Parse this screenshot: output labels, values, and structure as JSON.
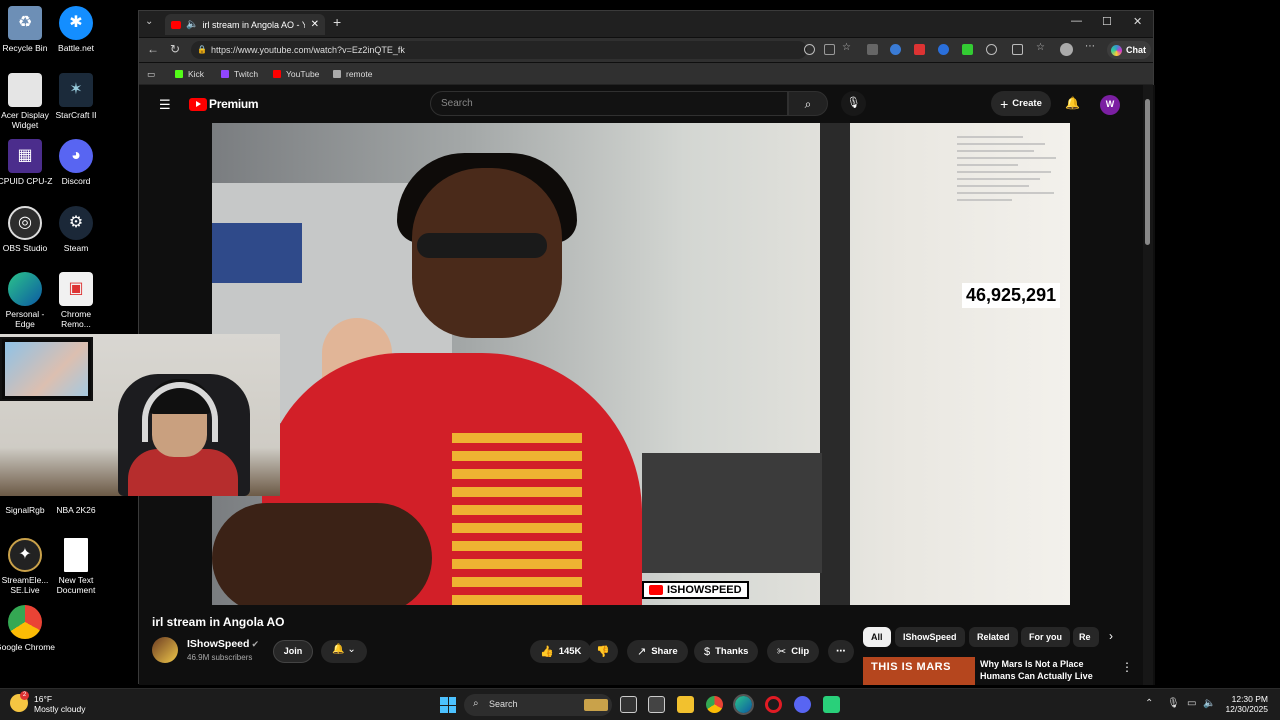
{
  "desktop": {
    "icons": [
      {
        "label": "Recycle Bin",
        "icon": "recycle-bin-icon"
      },
      {
        "label": "Battle.net",
        "icon": "battlenet-icon"
      },
      {
        "label": "Acer Display Widget",
        "icon": "acer-icon"
      },
      {
        "label": "StarCraft II",
        "icon": "starcraft-icon"
      },
      {
        "label": "CPUID CPU-Z",
        "icon": "cpuz-icon"
      },
      {
        "label": "Discord",
        "icon": "discord-icon"
      },
      {
        "label": "OBS Studio",
        "icon": "obs-icon"
      },
      {
        "label": "Steam",
        "icon": "steam-icon"
      },
      {
        "label": "Personal - Edge",
        "icon": "edge-icon"
      },
      {
        "label": "Chrome Remo...",
        "icon": "chrome-remote-icon"
      },
      {
        "label": "SignalRgb",
        "icon": "signalrgb-icon"
      },
      {
        "label": "NBA 2K26",
        "icon": "nba-icon"
      },
      {
        "label": "StreamEle... SE.Live",
        "icon": "streamelements-icon"
      },
      {
        "label": "New Text Document",
        "icon": "text-document-icon"
      },
      {
        "label": "Google Chrome",
        "icon": "chrome-icon"
      }
    ]
  },
  "browser": {
    "tab_title": "irl stream in Angola AO - YouTube",
    "url": "https://www.youtube.com/watch?v=Ez2inQTE_fk",
    "chat_label": "Chat",
    "bookmarks": [
      {
        "label": "Kick",
        "color": "#53fc18"
      },
      {
        "label": "Twitch",
        "color": "#9146ff"
      },
      {
        "label": "YouTube",
        "color": "#ff0000"
      },
      {
        "label": "remote",
        "color": "#aaaaaa"
      }
    ]
  },
  "youtube": {
    "brand": "Premium",
    "search_placeholder": "Search",
    "create_label": "Create",
    "avatar_letter": "W",
    "video": {
      "counter": "46,925,291",
      "watermark": "ISHOWSPEED"
    },
    "title": "irl stream in Angola AO",
    "channel": "IShowSpeed",
    "subscribers": "46.9M subscribers",
    "join_label": "Join",
    "actions": {
      "likes": "145K",
      "share": "Share",
      "thanks": "Thanks",
      "clip": "Clip"
    },
    "chips": [
      "All",
      "IShowSpeed",
      "Related",
      "For you",
      "Re"
    ],
    "recommendation": {
      "thumb_text": "THIS IS MARS",
      "title": "Why Mars Is Not a Place Humans Can Actually Live"
    }
  },
  "taskbar": {
    "temperature": "16°F",
    "weather": "Mostly cloudy",
    "notification_count": "2",
    "search": "Search",
    "time": "12:30 PM",
    "date": "12/30/2025"
  }
}
